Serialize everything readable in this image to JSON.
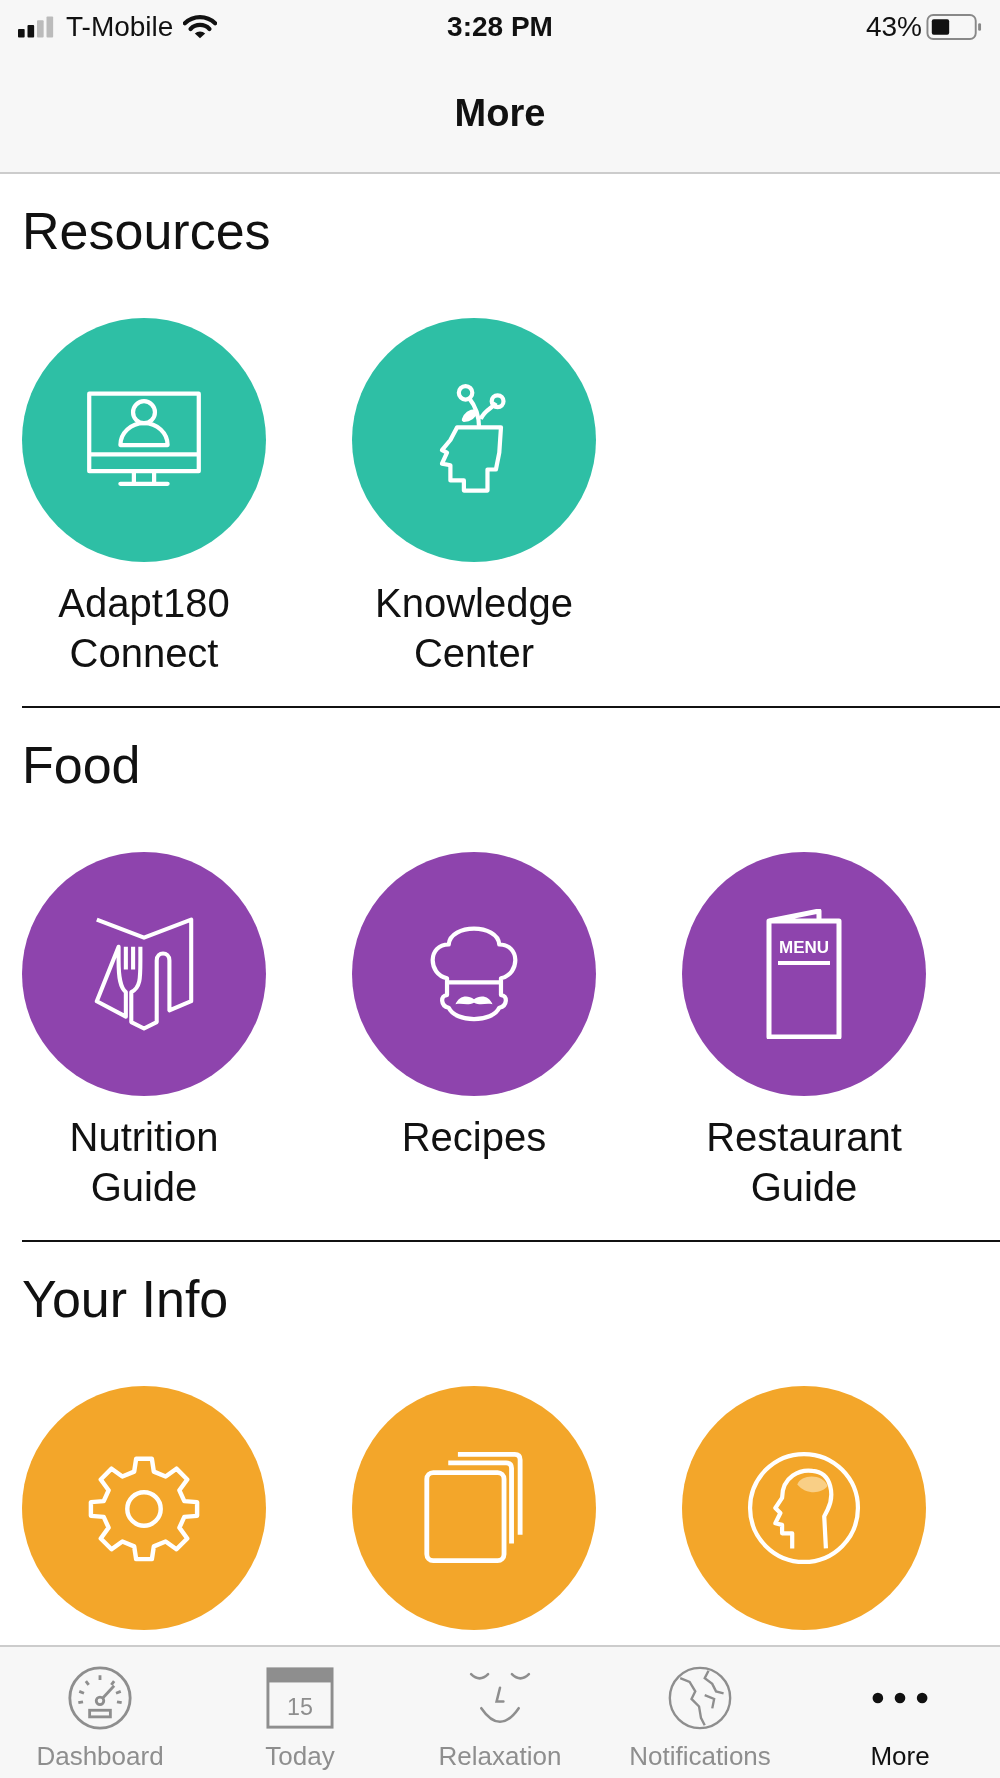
{
  "status_bar": {
    "carrier": "T-Mobile",
    "time": "3:28 PM",
    "battery": "43%"
  },
  "nav": {
    "title": "More"
  },
  "sections": [
    {
      "title": "Resources",
      "color": "#2ebfa5",
      "items": [
        {
          "kind": "monitor",
          "label": "Adapt180 Connect"
        },
        {
          "kind": "head-plant",
          "label": "Knowledge Center"
        }
      ]
    },
    {
      "title": "Food",
      "color": "#8e44ad",
      "items": [
        {
          "kind": "book-fork",
          "label": "Nutrition Guide"
        },
        {
          "kind": "chef",
          "label": "Recipes"
        },
        {
          "kind": "menu-card",
          "label": "Restaurant Guide",
          "icon_text": "MENU"
        }
      ]
    },
    {
      "title": "Your Info",
      "color": "#f3a62a",
      "items": [
        {
          "kind": "gear"
        },
        {
          "kind": "cards"
        },
        {
          "kind": "brain"
        }
      ]
    }
  ],
  "tabs": [
    {
      "kind": "gauge",
      "label": "Dashboard",
      "selected": false
    },
    {
      "kind": "calendar",
      "label": "Today",
      "icon_text": "15",
      "selected": false
    },
    {
      "kind": "face",
      "label": "Relaxation",
      "selected": false
    },
    {
      "kind": "globe",
      "label": "Notifications",
      "selected": false
    },
    {
      "kind": "dots",
      "label": "More",
      "selected": true
    }
  ]
}
